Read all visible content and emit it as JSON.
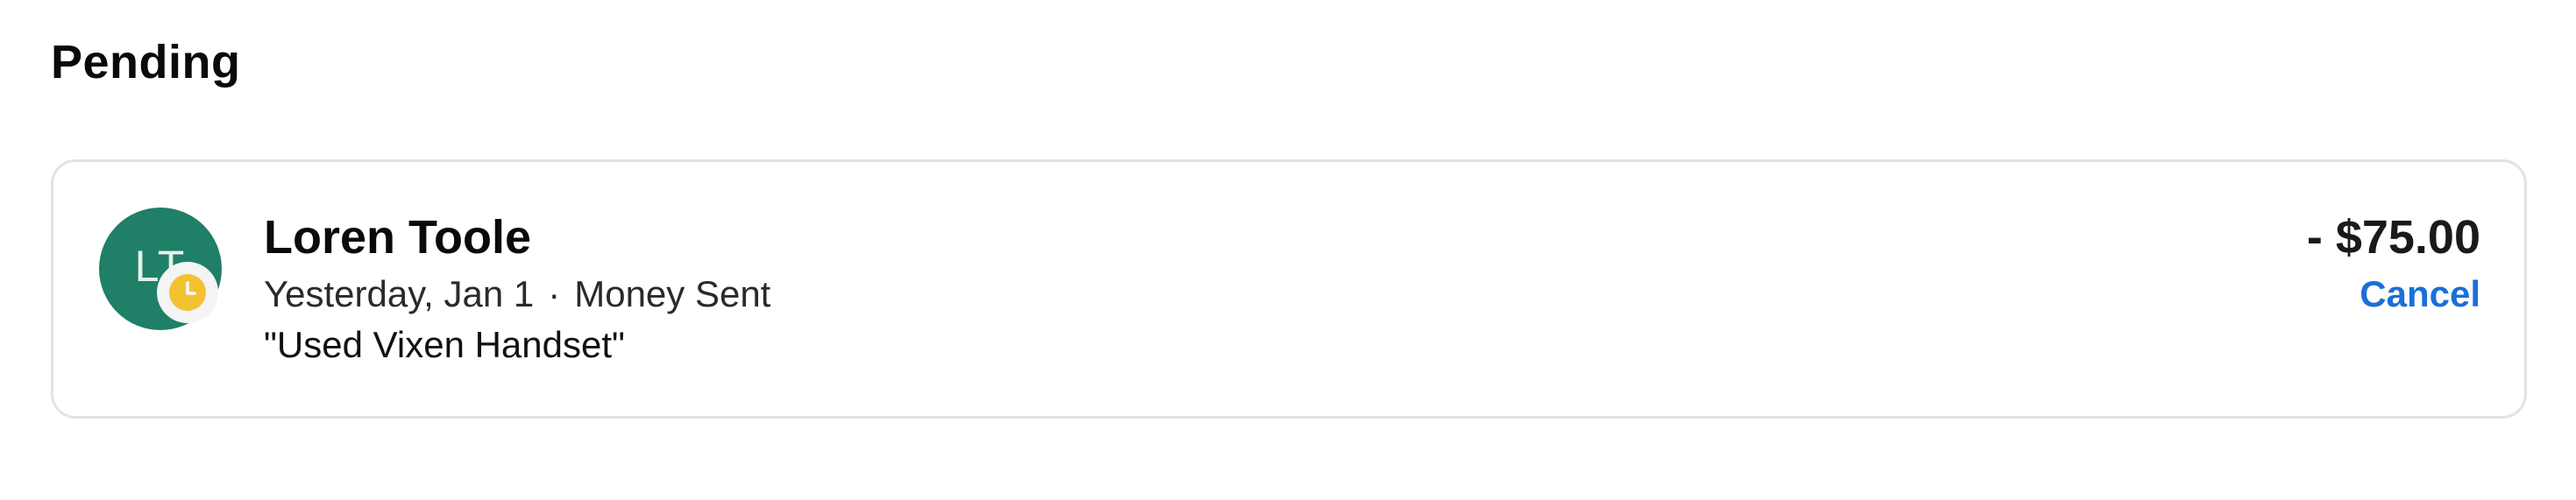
{
  "section": {
    "title": "Pending"
  },
  "transaction": {
    "avatar_initials": "LT",
    "avatar_bg": "#1f7f67",
    "avatar_fg": "#e6f2ee",
    "status_icon": "clock-icon",
    "status_color": "#f2c233",
    "name": "Loren Toole",
    "date": "Yesterday, Jan 1",
    "separator": "·",
    "type": "Money Sent",
    "note": "\"Used Vixen Handset\"",
    "amount": "- $75.00",
    "action_label": "Cancel",
    "action_color": "#1c6fd6"
  }
}
